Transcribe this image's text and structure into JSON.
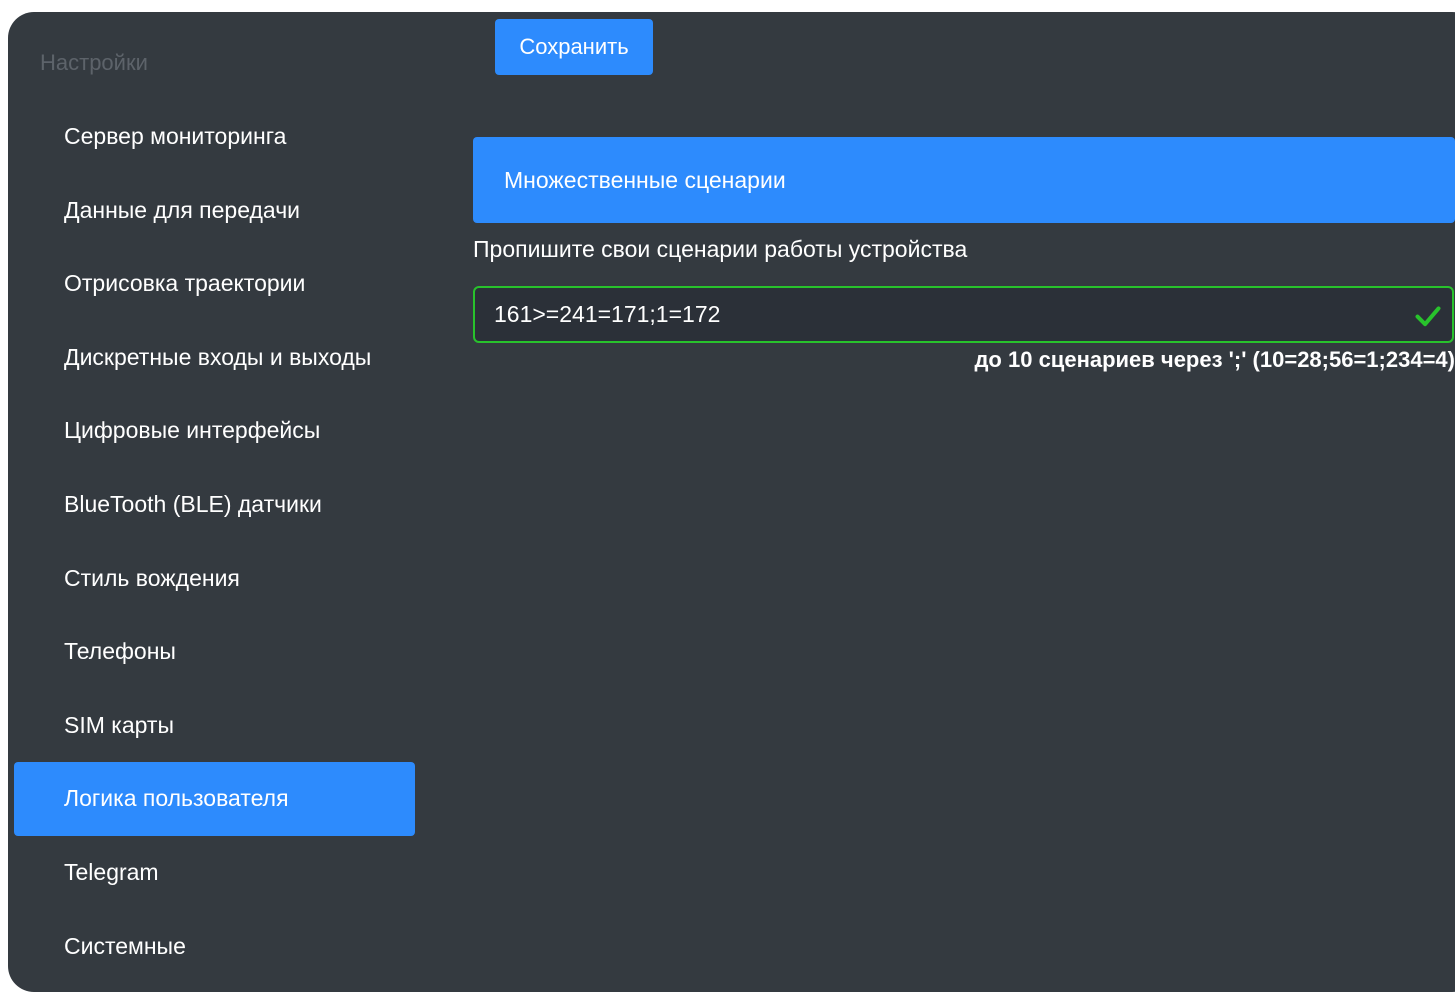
{
  "sidebar": {
    "title": "Настройки",
    "items": [
      {
        "label": "Сервер мониторинга"
      },
      {
        "label": "Данные для передачи"
      },
      {
        "label": "Отрисовка траектории"
      },
      {
        "label": "Дискретные входы и выходы"
      },
      {
        "label": "Цифровые интерфейсы"
      },
      {
        "label": "BlueTooth (BLE) датчики"
      },
      {
        "label": "Стиль вождения"
      },
      {
        "label": "Телефоны"
      },
      {
        "label": "SIM карты"
      },
      {
        "label": "Логика пользователя"
      },
      {
        "label": "Telegram"
      },
      {
        "label": "Системные"
      }
    ],
    "active_item": "Логика пользователя"
  },
  "toolbar": {
    "save_label": "Сохранить"
  },
  "section": {
    "title": "Множественные сценарии",
    "field_label": "Пропишите свои сценарии работы устройства",
    "field_value": "161>=241=171;1=172",
    "hint": "до 10 сценариев через ';' (10=28;56=1;234=4)",
    "validation_icon": "check-icon"
  },
  "colors": {
    "background": "#343a40",
    "accent": "#2d8bfd",
    "valid": "#28c22c",
    "sidebar_title": "#5d636a"
  }
}
